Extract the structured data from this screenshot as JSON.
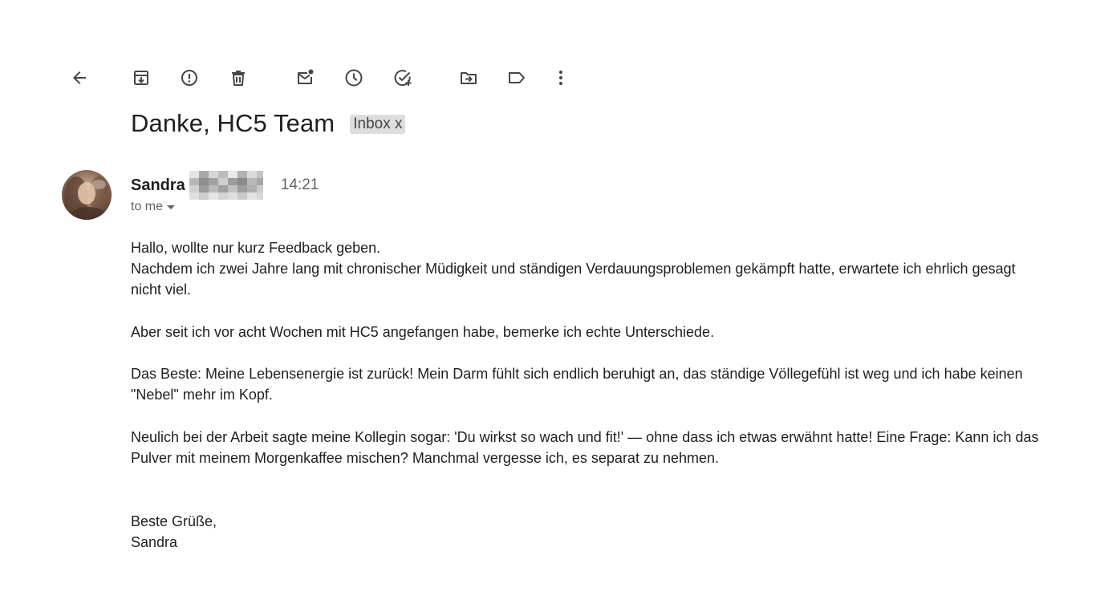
{
  "toolbar": {
    "icons": [
      "back-arrow-icon",
      "archive-icon",
      "report-spam-icon",
      "delete-icon",
      "mark-unread-icon",
      "snooze-icon",
      "add-task-icon",
      "move-to-icon",
      "label-icon",
      "more-options-icon"
    ]
  },
  "email": {
    "subject": "Danke, HC5 Team",
    "label": "Inbox x",
    "sender_first_name": "Sandra",
    "time": "14:21",
    "recipient": "to me",
    "body": {
      "greeting": "Hallo, wollte nur kurz Feedback geben.",
      "p1": "Nachdem ich zwei Jahre lang mit chronischer Müdigkeit und ständigen Verdauungsproblemen gekämpft hatte, erwartete ich ehrlich gesagt nicht viel.",
      "p2": "Aber seit ich vor acht Wochen mit HC5 angefangen habe, bemerke ich echte Unterschiede.",
      "p3": "Das Beste: Meine Lebensenergie ist zurück! Mein Darm fühlt sich endlich beruhigt an, das ständige Völlegefühl ist weg und ich habe keinen \"Nebel\" mehr im Kopf.",
      "p4": "Neulich bei der Arbeit sagte meine Kollegin sogar: 'Du wirkst so wach und fit!' — ohne dass ich etwas erwähnt hatte! Eine Frage: Kann ich das Pulver mit meinem Morgenkaffee mischen? Manchmal vergesse ich, es separat zu nehmen.",
      "closing": "Beste Grüße,",
      "signature": "Sandra"
    }
  },
  "colors": {
    "icon": "#444746",
    "text": "#1f1f1f",
    "muted": "#5f6368",
    "chip_bg": "#dddddd"
  }
}
